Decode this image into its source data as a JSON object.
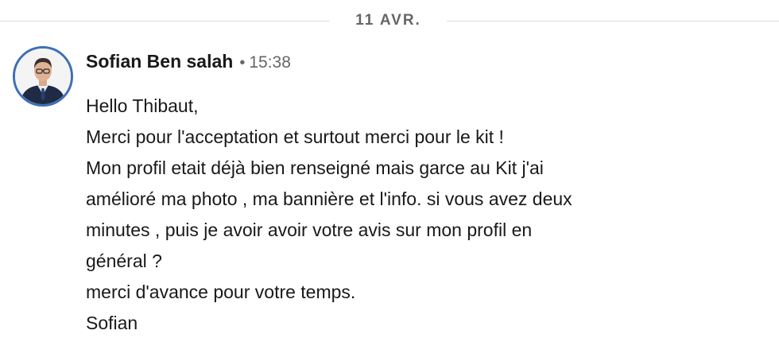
{
  "date_divider": {
    "label": "11 AVR."
  },
  "message": {
    "sender": "Sofian Ben salah",
    "separator": "•",
    "time": "15:38",
    "lines": [
      "Hello Thibaut,",
      "Merci pour l'acceptation et surtout merci pour le kit !",
      "Mon profil etait déjà bien renseigné mais garce au Kit j'ai",
      "amélioré ma photo , ma bannière et l'info. si vous avez deux",
      "minutes , puis je avoir avoir votre avis sur mon profil en",
      "général ?",
      "merci d'avance pour votre temps.",
      "Sofian"
    ]
  },
  "colors": {
    "avatar_ring": "#3f6fb5",
    "text_primary": "#191919",
    "text_secondary": "#666666",
    "divider": "#dcdcdc"
  },
  "icons": {
    "avatar": "profile-photo"
  }
}
